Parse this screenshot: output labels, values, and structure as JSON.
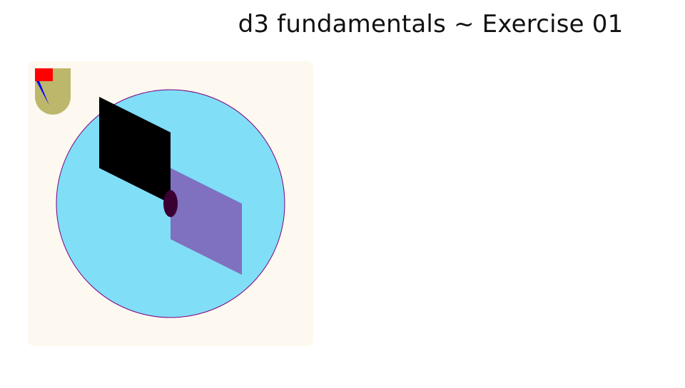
{
  "page": {
    "title": "d3 fundamentals ~ Exercise 01"
  },
  "palette": {
    "canvas_bg": "#fdf9f0",
    "circle_fill": "#80def7",
    "circle_stroke": "#800080",
    "black_shape": "#000000",
    "purple_shape": "#8070c0",
    "dark_ellipse": "#3b0032",
    "badge_fill": "#bdb76b",
    "badge_red": "#ff0000",
    "badge_blue": "#0000ff"
  }
}
